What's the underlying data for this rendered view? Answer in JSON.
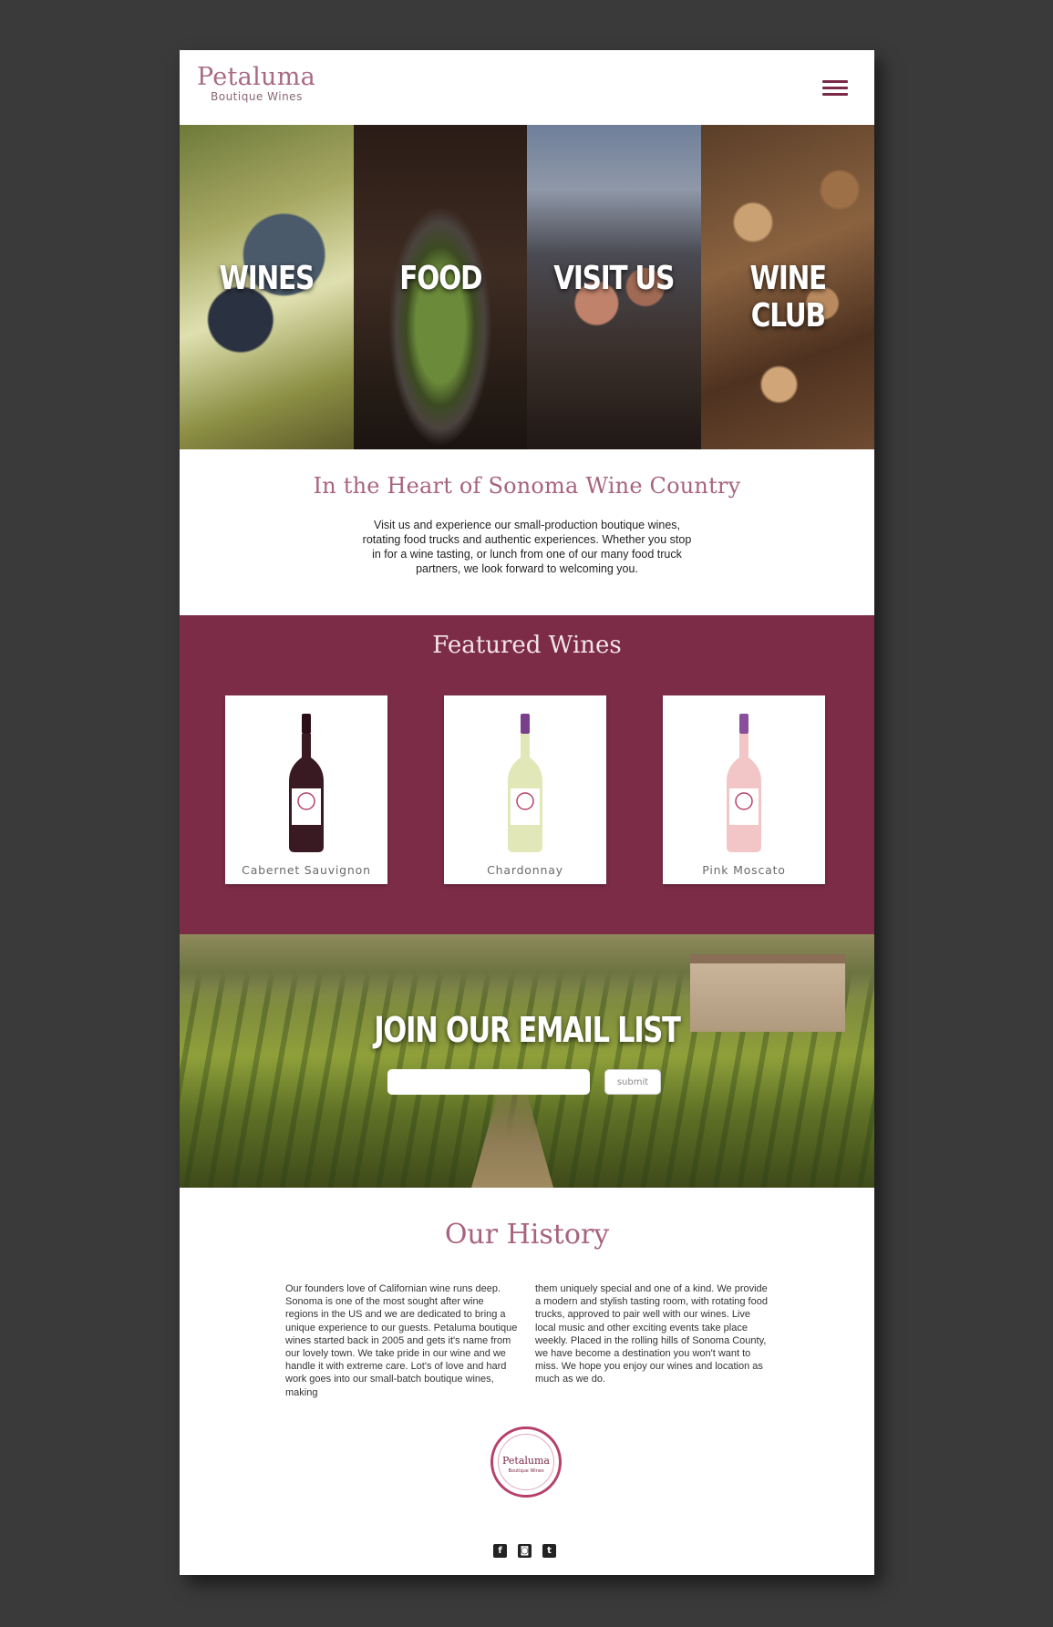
{
  "header": {
    "logo_name": "Petaluma",
    "logo_sub": "Boutique Wines",
    "menu_icon": "hamburger-menu-icon"
  },
  "tiles": [
    {
      "label": "WINES"
    },
    {
      "label": "FOOD"
    },
    {
      "label": "VISIT US"
    },
    {
      "label": "WINE CLUB"
    }
  ],
  "intro": {
    "title": "In the Heart of Sonoma Wine Country",
    "text": "Visit us and experience our small-production boutique wines, rotating food trucks and authentic experiences. Whether you stop in for a wine tasting, or lunch from one of our many food truck partners, we look forward to welcoming you."
  },
  "featured": {
    "title": "Featured Wines",
    "wines": [
      {
        "name": "Cabernet Sauvignon",
        "bottle_color": "#3a1a22",
        "cap_color": "#2a0e18"
      },
      {
        "name": "Chardonnay",
        "bottle_color": "#e2e7b8",
        "cap_color": "#7a3f8a"
      },
      {
        "name": "Pink Moscato",
        "bottle_color": "#f2c6c6",
        "cap_color": "#8a4f9a"
      }
    ]
  },
  "email": {
    "title": "JOIN OUR EMAIL LIST",
    "input_placeholder": "",
    "submit_label": "submit"
  },
  "history": {
    "title": "Our History",
    "col1": "Our founders love of Californian wine runs deep. Sonoma is one of the most sought after wine regions in the US and we are dedicated to bring a unique experience to our guests. Petaluma boutique wines started back in 2005 and gets it's name from our lovely town. We take pride in our wine and we handle it with extreme care. Lot's of love and hard work goes into our small-batch boutique wines, making",
    "col2": "them uniquely special and one of a kind. We provide a modern and stylish tasting room, with rotating food trucks, approved to pair well with our wines. Live local music and other exciting events take place weekly. Placed in the rolling hills of Sonoma County, we have become a destination you won't want to miss. We hope you enjoy our wines and location as much as we do.",
    "stamp_name": "Petaluma",
    "stamp_sub": "Boutique Wines"
  },
  "socials": [
    {
      "icon": "facebook-icon",
      "glyph": "f"
    },
    {
      "icon": "instagram-icon",
      "glyph": "◙"
    },
    {
      "icon": "twitter-icon",
      "glyph": "t"
    }
  ],
  "colors": {
    "brand": "#7d2c48",
    "accent_text": "#a8637f",
    "backdrop": "#3a3a3a"
  }
}
